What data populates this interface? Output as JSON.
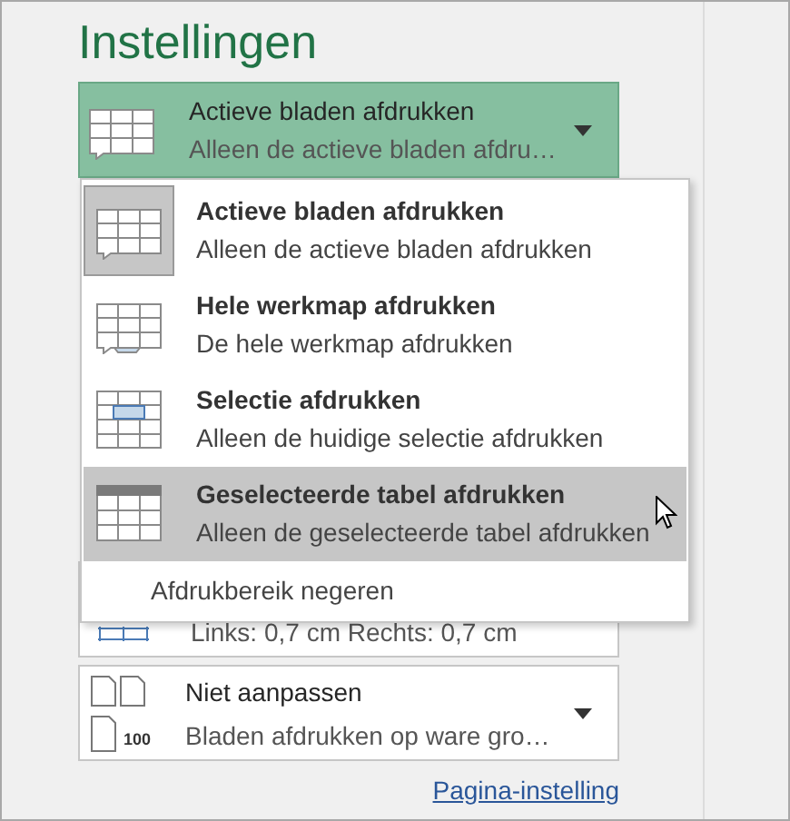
{
  "heading": "Instellingen",
  "print_what": {
    "title": "Actieve bladen afdrukken",
    "subtitle": "Alleen de actieve bladen afdru…"
  },
  "menu": {
    "items": [
      {
        "kind": "sheets",
        "title": "Actieve bladen afdrukken",
        "subtitle": "Alleen de actieve bladen afdrukken",
        "selected": true,
        "hovered": false
      },
      {
        "kind": "workbook",
        "title": "Hele werkmap afdrukken",
        "subtitle": "De hele werkmap afdrukken",
        "selected": false,
        "hovered": false
      },
      {
        "kind": "selection",
        "title": "Selectie afdrukken",
        "subtitle": "Alleen de huidige selectie afdrukken",
        "selected": false,
        "hovered": false
      },
      {
        "kind": "table",
        "title": "Geselecteerde tabel afdrukken",
        "subtitle": "Alleen de geselecteerde tabel afdrukken",
        "selected": false,
        "hovered": true
      }
    ],
    "footer": "Afdrukbereik negeren"
  },
  "margins": {
    "subtitle": "Links: 0,7 cm Rechts: 0,7 cm"
  },
  "scaling": {
    "title": "Niet aanpassen",
    "subtitle": "Bladen afdrukken op ware gro…",
    "icon_number": "100"
  },
  "link": "Pagina-instelling"
}
